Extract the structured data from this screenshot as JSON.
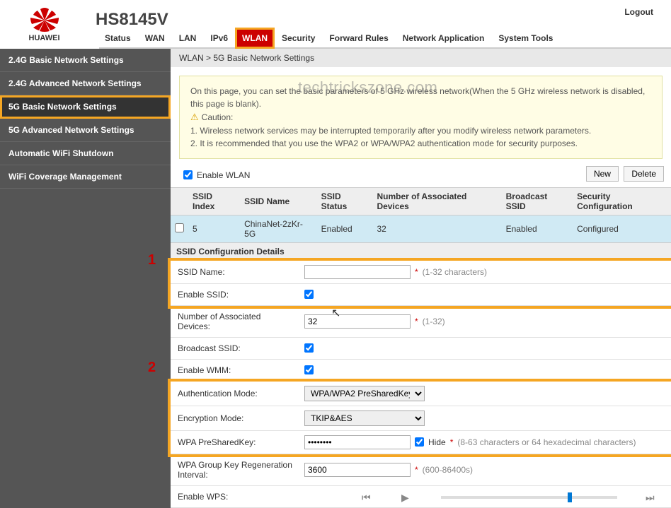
{
  "header": {
    "brand": "HUAWEI",
    "model": "HS8145V",
    "logout": "Logout"
  },
  "topnav": [
    {
      "label": "Status"
    },
    {
      "label": "WAN"
    },
    {
      "label": "LAN"
    },
    {
      "label": "IPv6"
    },
    {
      "label": "WLAN",
      "active": true
    },
    {
      "label": "Security"
    },
    {
      "label": "Forward Rules"
    },
    {
      "label": "Network Application"
    },
    {
      "label": "System Tools"
    }
  ],
  "sidebar": [
    {
      "label": "2.4G Basic Network Settings"
    },
    {
      "label": "2.4G Advanced Network Settings"
    },
    {
      "label": "5G Basic Network Settings",
      "active": true
    },
    {
      "label": "5G Advanced Network Settings"
    },
    {
      "label": "Automatic WiFi Shutdown"
    },
    {
      "label": "WiFi Coverage Management"
    }
  ],
  "breadcrumb": "WLAN > 5G Basic Network Settings",
  "notice": {
    "line1": "On this page, you can set the basic parameters of 5 GHz wireless network(When the 5 GHz wireless network is disabled, this page is blank).",
    "caution_label": "Caution:",
    "line2": "1. Wireless network services may be interrupted temporarily after you modify wireless network parameters.",
    "line3": "2. It is recommended that you use the WPA2 or WPA/WPA2 authentication mode for security purposes."
  },
  "enable_wlan": {
    "label": "Enable WLAN",
    "checked": true
  },
  "buttons": {
    "new": "New",
    "delete": "Delete"
  },
  "table": {
    "headers": [
      "SSID Index",
      "SSID Name",
      "SSID Status",
      "Number of Associated Devices",
      "Broadcast SSID",
      "Security Configuration"
    ],
    "rows": [
      {
        "index": "5",
        "name": "ChinaNet-2zKr-5G",
        "status": "Enabled",
        "devices": "32",
        "broadcast": "Enabled",
        "security": "Configured"
      }
    ]
  },
  "section_title": "SSID Configuration Details",
  "form": {
    "ssid_name": {
      "label": "SSID Name:",
      "value": "",
      "hint": "(1-32 characters)"
    },
    "enable_ssid": {
      "label": "Enable SSID:",
      "checked": true
    },
    "num_devices": {
      "label": "Number of Associated Devices:",
      "value": "32",
      "hint": "(1-32)"
    },
    "broadcast_ssid": {
      "label": "Broadcast SSID:",
      "checked": true
    },
    "enable_wmm": {
      "label": "Enable WMM:",
      "checked": true
    },
    "auth_mode": {
      "label": "Authentication Mode:",
      "value": "WPA/WPA2 PreSharedKey"
    },
    "enc_mode": {
      "label": "Encryption Mode:",
      "value": "TKIP&AES"
    },
    "psk": {
      "label": "WPA PreSharedKey:",
      "value": "••••••••",
      "hide_label": "Hide",
      "hide_checked": true,
      "hint": "(8-63 characters or 64 hexadecimal characters)"
    },
    "rekey": {
      "label": "WPA Group Key Regeneration Interval:",
      "value": "3600",
      "hint": "(600-86400s)"
    },
    "enable_wps": {
      "label": "Enable WPS:"
    }
  },
  "watermark": "techtrickszone.com",
  "annotations": {
    "n1": "1",
    "n2": "2"
  }
}
